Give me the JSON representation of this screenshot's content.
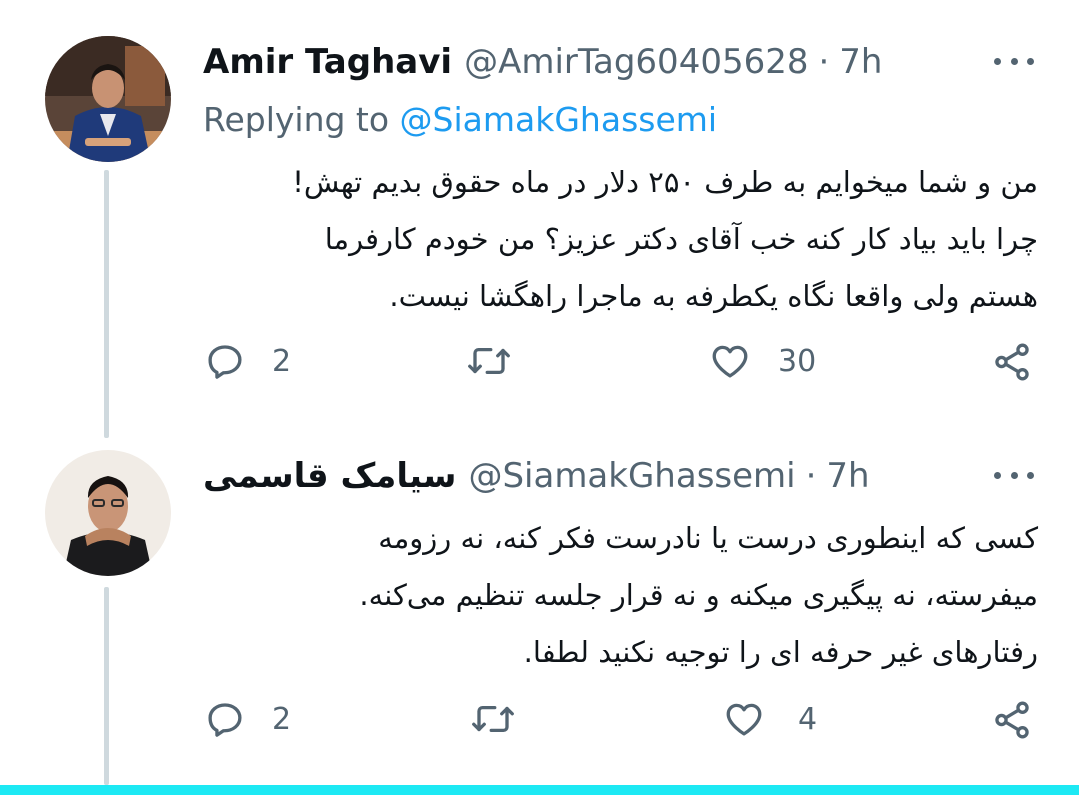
{
  "tweets": [
    {
      "name": "Amir Taghavi",
      "handle": "@AmirTag60405628",
      "separator": "·",
      "time": "7h",
      "replying_prefix": "Replying to",
      "replying_to": "@SiamakGhassemi",
      "lines": [
        "من و شما میخوایم به طرف ۲۵۰ دلار در ماه حقوق بدیم تهش!",
        "چرا باید بیاد کار کنه خب آقای دکتر عزیز؟ من خودم کارفرما",
        "هستم ولی واقعا نگاه یکطرفه به ماجرا راهگشا نیست."
      ],
      "reply_count": "2",
      "like_count": "30"
    },
    {
      "name": "سیامک قاسمی",
      "handle": "@SiamakGhassemi",
      "separator": "·",
      "time": "7h",
      "lines": [
        "کسی که اینطوری درست یا نادرست فکر کنه، نه رزومه",
        "میفرسته، نه پیگیری میکنه و نه قرار جلسه تنظیم می‌کنه.",
        "رفتارهای غیر حرفه ای را توجیه نکنید لطفا."
      ],
      "reply_count": "2",
      "like_count": "4"
    }
  ],
  "icons": [
    "reply-icon",
    "retweet-icon",
    "like-icon",
    "share-icon",
    "more-icon"
  ],
  "colors": {
    "accent": "#1d9bf0",
    "secondary_text": "#536471",
    "thread_line": "#cfd9de",
    "bottom_bar": "#1de9f4"
  }
}
